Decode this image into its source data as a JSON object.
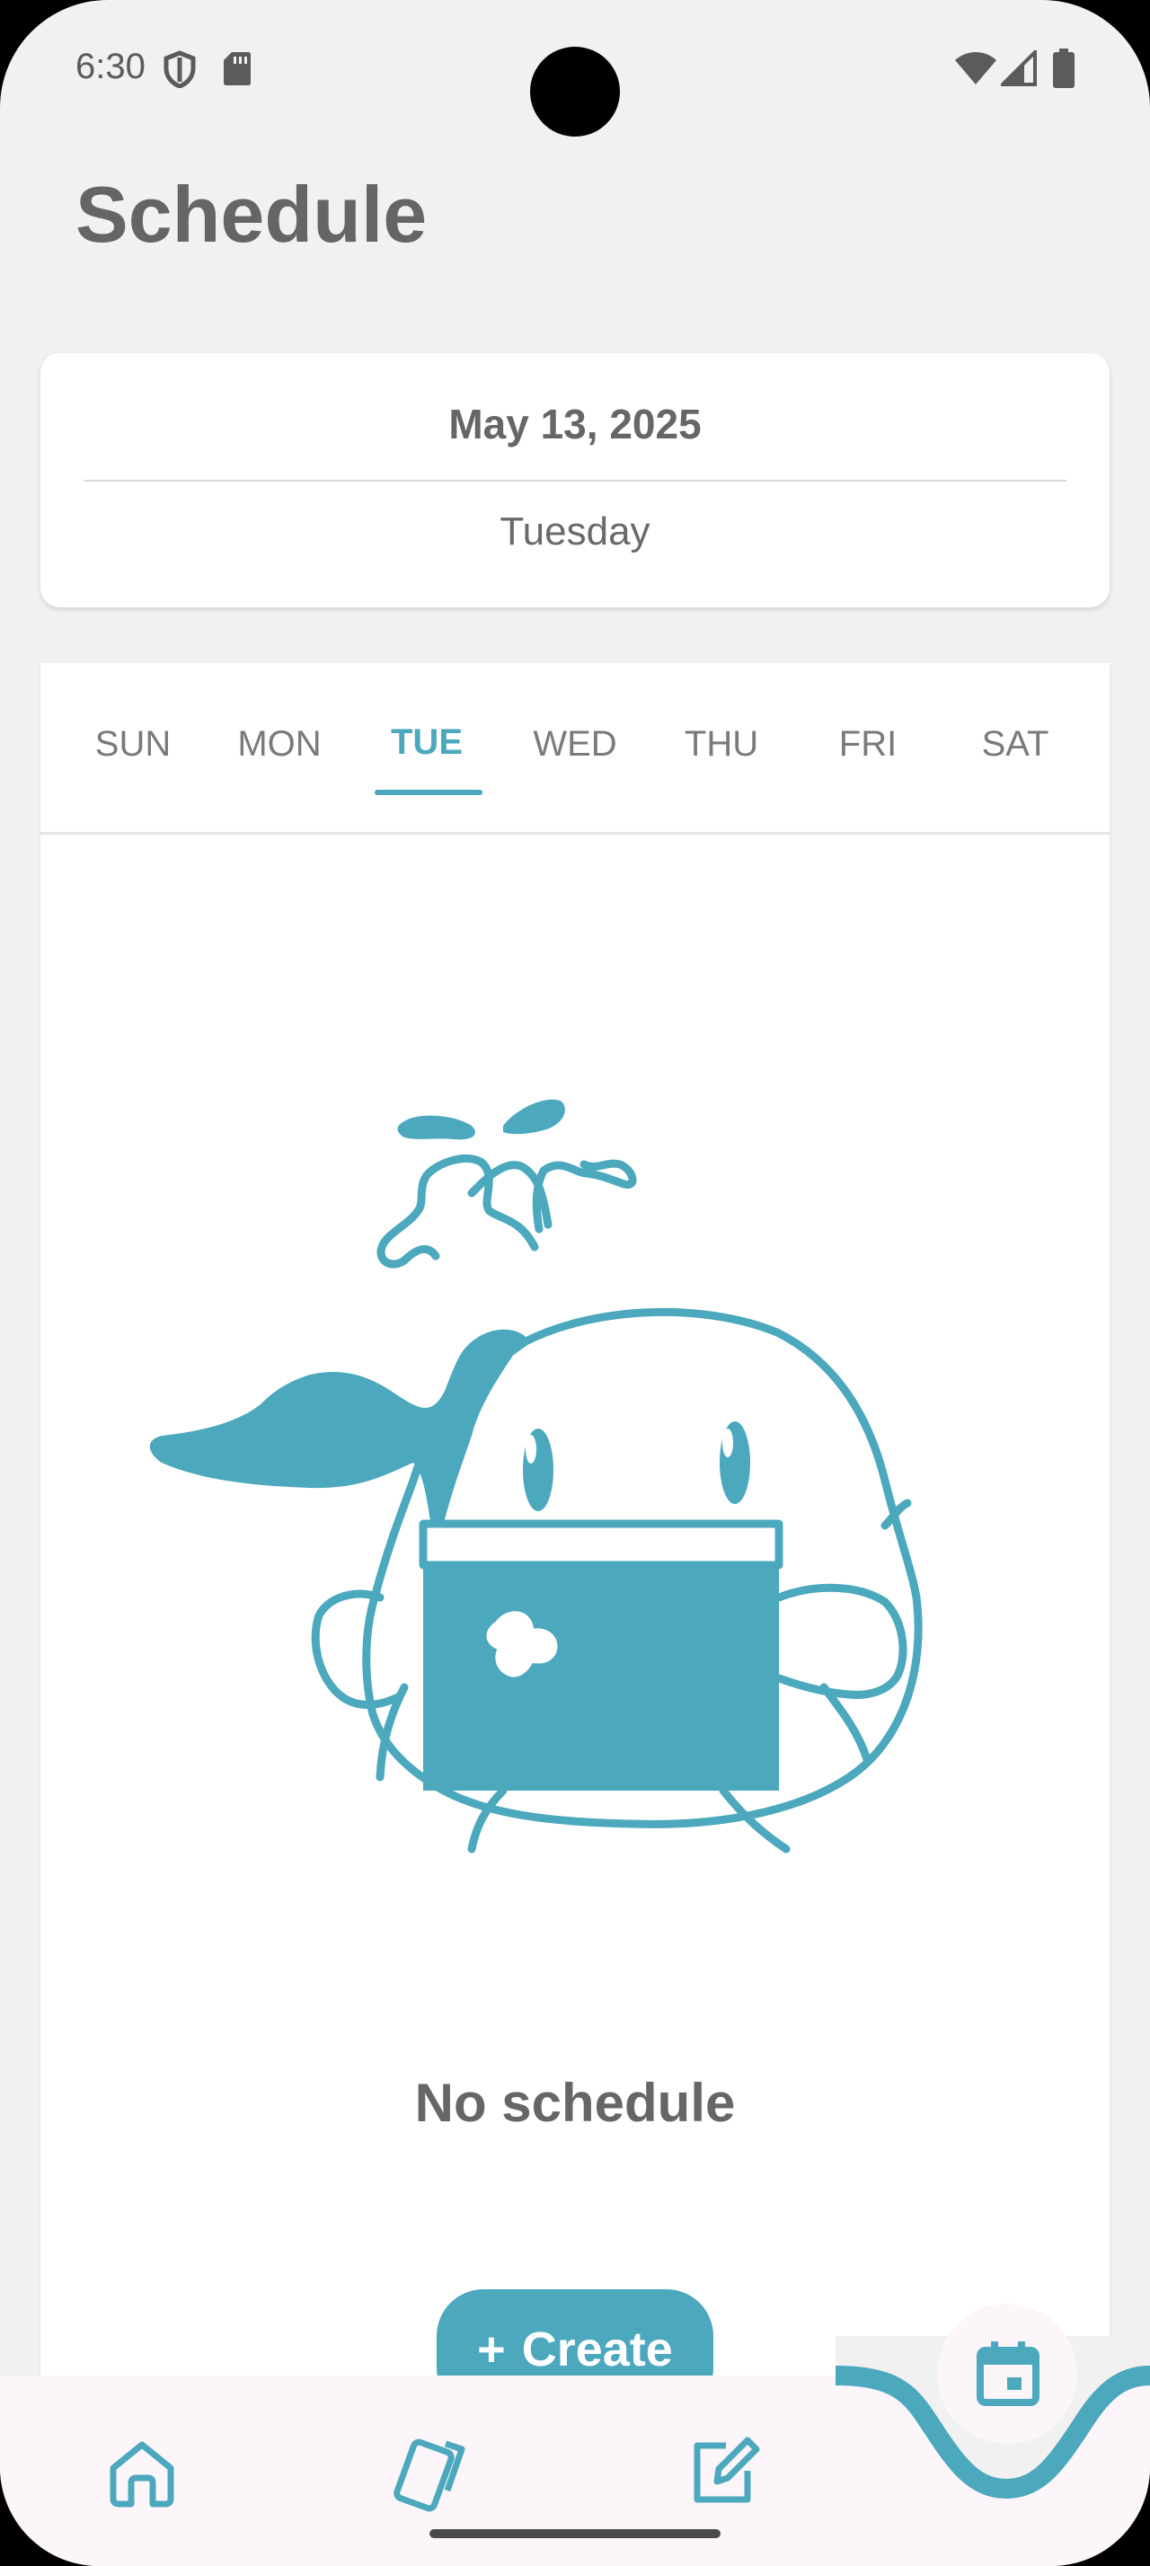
{
  "status_bar": {
    "time": "6:30",
    "icons": [
      "shield-icon",
      "sd-card-icon",
      "wifi-icon",
      "cell-signal-icon",
      "battery-icon"
    ]
  },
  "header": {
    "title": "Schedule"
  },
  "date_card": {
    "date": "May 13, 2025",
    "weekday": "Tuesday"
  },
  "day_tabs": {
    "items": [
      {
        "label": "SUN"
      },
      {
        "label": "MON"
      },
      {
        "label": "TUE"
      },
      {
        "label": "WED"
      },
      {
        "label": "THU"
      },
      {
        "label": "FRI"
      },
      {
        "label": "SAT"
      }
    ],
    "selected": "TUE"
  },
  "empty_state": {
    "message": "No schedule",
    "illustration": "whale-with-calendar-illustration",
    "create_label": "Create"
  },
  "bottom_nav": {
    "items": [
      {
        "icon": "home-icon"
      },
      {
        "icon": "cards-icon"
      },
      {
        "icon": "edit-note-icon"
      },
      {
        "icon": "calendar-icon"
      }
    ],
    "active": "calendar-icon"
  },
  "colors": {
    "accent": "#4ba8bd",
    "background": "#f1f1f1",
    "nav_background": "#fcf6fb",
    "text_primary": "#666666"
  }
}
